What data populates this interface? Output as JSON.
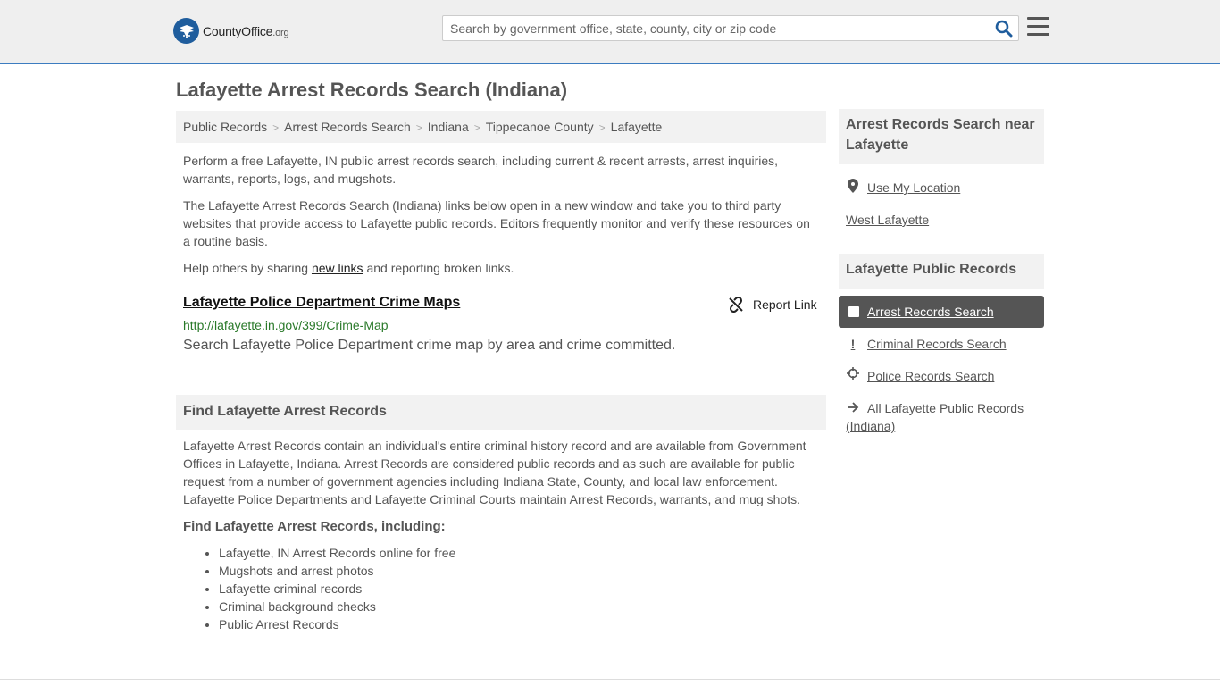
{
  "header": {
    "logo_main": "CountyOffice",
    "logo_suffix": ".org",
    "search_placeholder": "Search by government office, state, county, city or zip code"
  },
  "page_title": "Lafayette Arrest Records Search (Indiana)",
  "breadcrumb": [
    "Public Records",
    "Arrest Records Search",
    "Indiana",
    "Tippecanoe County",
    "Lafayette"
  ],
  "intro": {
    "p1": "Perform a free Lafayette, IN public arrest records search, including current & recent arrests, arrest inquiries, warrants, reports, logs, and mugshots.",
    "p2": "The Lafayette Arrest Records Search (Indiana) links below open in a new window and take you to third party websites that provide access to Lafayette public records. Editors frequently monitor and verify these resources on a routine basis.",
    "p3_before": "Help others by sharing ",
    "p3_link": "new links",
    "p3_after": " and reporting broken links."
  },
  "result": {
    "title": "Lafayette Police Department Crime Maps",
    "report_label": "Report Link",
    "url": "http://lafayette.in.gov/399/Crime-Map",
    "description": "Search Lafayette Police Department crime map by area and crime committed."
  },
  "find_section": {
    "heading": "Find Lafayette Arrest Records",
    "body": "Lafayette Arrest Records contain an individual's entire criminal history record and are available from Government Offices in Lafayette, Indiana. Arrest Records are considered public records and as such are available for public request from a number of government agencies including Indiana State, County, and local law enforcement. Lafayette Police Departments and Lafayette Criminal Courts maintain Arrest Records, warrants, and mug shots.",
    "subheading": "Find Lafayette Arrest Records, including:",
    "items": [
      "Lafayette, IN Arrest Records online for free",
      "Mugshots and arrest photos",
      "Lafayette criminal records",
      "Criminal background checks",
      "Public Arrest Records"
    ]
  },
  "sidebar": {
    "near_heading": "Arrest Records Search near Lafayette",
    "use_location": "Use My Location",
    "nearby": "West Lafayette",
    "public_heading": "Lafayette Public Records",
    "links": [
      {
        "label": "Arrest Records Search",
        "icon": "square-icon"
      },
      {
        "label": "Criminal Records Search",
        "icon": "exclamation-icon"
      },
      {
        "label": "Police Records Search",
        "icon": "crosshair-icon"
      },
      {
        "label": "All Lafayette Public Records (Indiana)",
        "icon": "arrow-right-icon"
      }
    ]
  }
}
